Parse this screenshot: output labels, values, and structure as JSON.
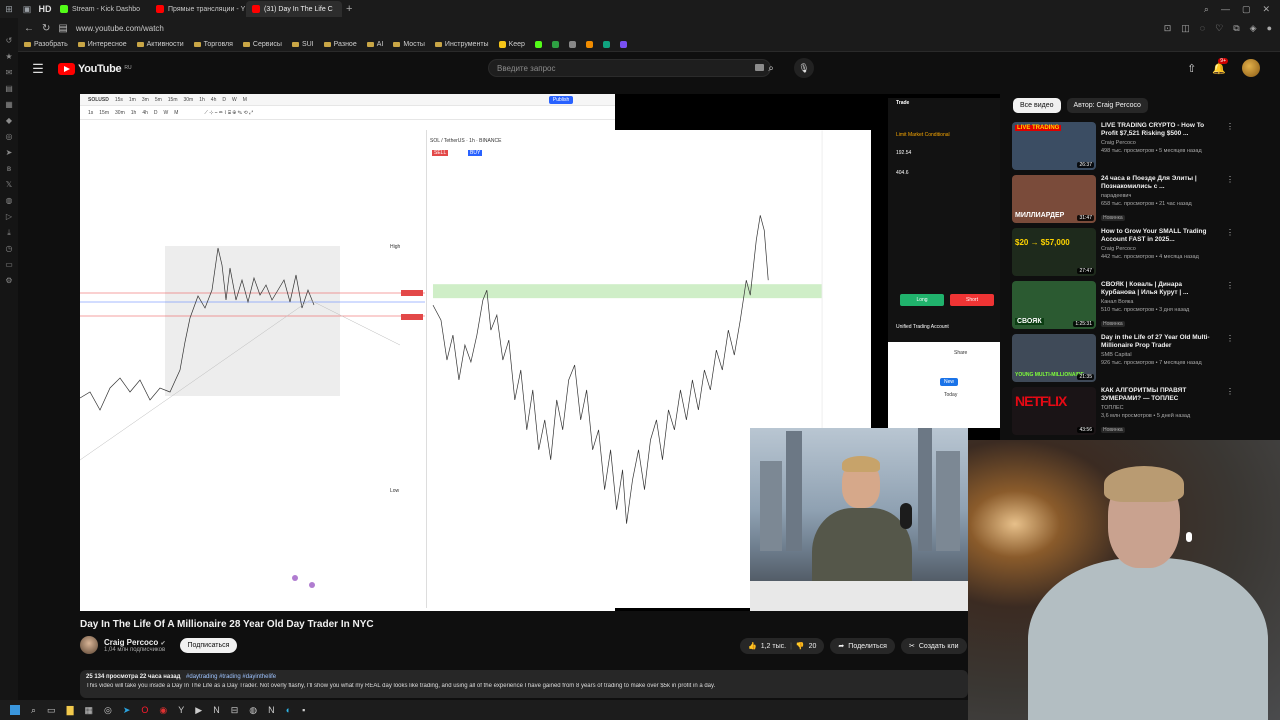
{
  "browser": {
    "tabs": [
      {
        "label": "Stream - Kick Dashbo",
        "color": "#53fc18",
        "active": false
      },
      {
        "label": "Прямые трансляции - Y",
        "color": "#ff0000",
        "active": false
      },
      {
        "label": "(31) Day In The Life C",
        "color": "#ff0000",
        "active": true
      }
    ],
    "url": "www.youtube.com/watch",
    "bookmarks": [
      "Разобрать",
      "Интересное",
      "Активности",
      "Торговля",
      "Сервисы",
      "SUI",
      "Разное",
      "AI",
      "Мосты",
      "Инструменты",
      "Keep"
    ]
  },
  "youtube": {
    "logo_text": "YouTube",
    "logo_country": "RU",
    "search_placeholder": "Введите запрос",
    "notifications": "9+"
  },
  "player": {
    "tv_symbol": "SOLUSD",
    "tv_symbol2": "SOL / TetherUS · 1h · BINANCE",
    "tv_publish": "Publish",
    "tv_sell": "SELL",
    "tv_buy": "BUY",
    "tv_high": "High",
    "tv_low": "Low",
    "trade_title": "Trade",
    "trade_tabs": "Limit   Market   Conditional",
    "trade_price": "192.54",
    "trade_qty": "404.6",
    "long_label": "Long",
    "short_label": "Short",
    "unified": "Unified Trading Account",
    "share": "Share",
    "new": "New",
    "today": "Today"
  },
  "video": {
    "title": "Day In The Life Of A Millionaire 28 Year Old Day Trader In NYC",
    "channel": "Craig Percoco",
    "subscribers": "1,04 млн подписчиков",
    "subscribe": "Подписаться",
    "likes": "1,2 тыс.",
    "dislikes": "20",
    "share": "Поделиться",
    "create_clip": "Создать кли",
    "views_date": "25 134 просмотра  22 часа назад",
    "hashtags": "#daytrading #trading #dayinthelife",
    "description": "This video will take you inside a Day In The Life as a Day Trader. Not overly flashy, I'll show you what my REAL day looks like trading, and using all of the experience I have gained from 8 years of trading to make over $5k in profit in a day."
  },
  "sidebar": {
    "chips": [
      "Все видео",
      "Автор: Craig Percoco"
    ],
    "items": [
      {
        "title": "LIVE TRADING CRYPTO - How To Profit $7,521 Risking $500 ...",
        "channel": "Craig Percoco",
        "meta": "498 тыс. просмотров • 5 месяцев назад",
        "duration": "26:37",
        "badge": "",
        "thumb_caption": "LIVE TRADING",
        "thumb_bg": "#3b4d63"
      },
      {
        "title": "24 часа в Поезде Для Элиты | Познакомились с ...",
        "channel": "парадеевич",
        "meta": "658 тыс. просмотров • 21 час назад",
        "duration": "31:47",
        "badge": "Новинка",
        "thumb_caption": "МИЛЛИАРДЕР",
        "thumb_bg": "#7a4b3a"
      },
      {
        "title": "How to Grow Your SMALL Trading Account FAST in 2025...",
        "channel": "Craig Percoco",
        "meta": "442 тыс. просмотров • 4 месяца назад",
        "duration": "27:47",
        "badge": "",
        "thumb_caption": "$20 → $57,000",
        "thumb_bg": "#1e2a1c"
      },
      {
        "title": "СВОЯК | Коваль | Динара Курбанова | Илья Курут | ...",
        "channel": "Канал Вояка",
        "meta": "510 тыс. просмотров • 3 дня назад",
        "duration": "1:25:31",
        "badge": "Новинка",
        "thumb_caption": "СВОЯК",
        "thumb_bg": "#2b5a31"
      },
      {
        "title": "Day in the Life of 27 Year Old Multi-Millionaire Prop Trader",
        "channel": "SMB Capital",
        "meta": "926 тыс. просмотров • 7 месяцев назад",
        "duration": "21:35",
        "badge": "",
        "thumb_caption": "YOUNG MULTI-MILLIONAIRE",
        "thumb_bg": "#3f4a58"
      },
      {
        "title": "КАК АЛГОРИТМЫ ПРАВЯТ ЗУМЕРАМИ? — ТОПЛЕС",
        "channel": "ТОПЛЕС",
        "meta": "3,6 млн просмотров • 5 дней назад",
        "duration": "43:56",
        "badge": "Новинка",
        "thumb_caption": "NETFLIX",
        "thumb_bg": "#1a1416"
      }
    ]
  },
  "colors": {
    "accent": "#ff0000",
    "chip_active": "#f1f1f1",
    "long": "#20b26c",
    "short": "#ef3434"
  }
}
